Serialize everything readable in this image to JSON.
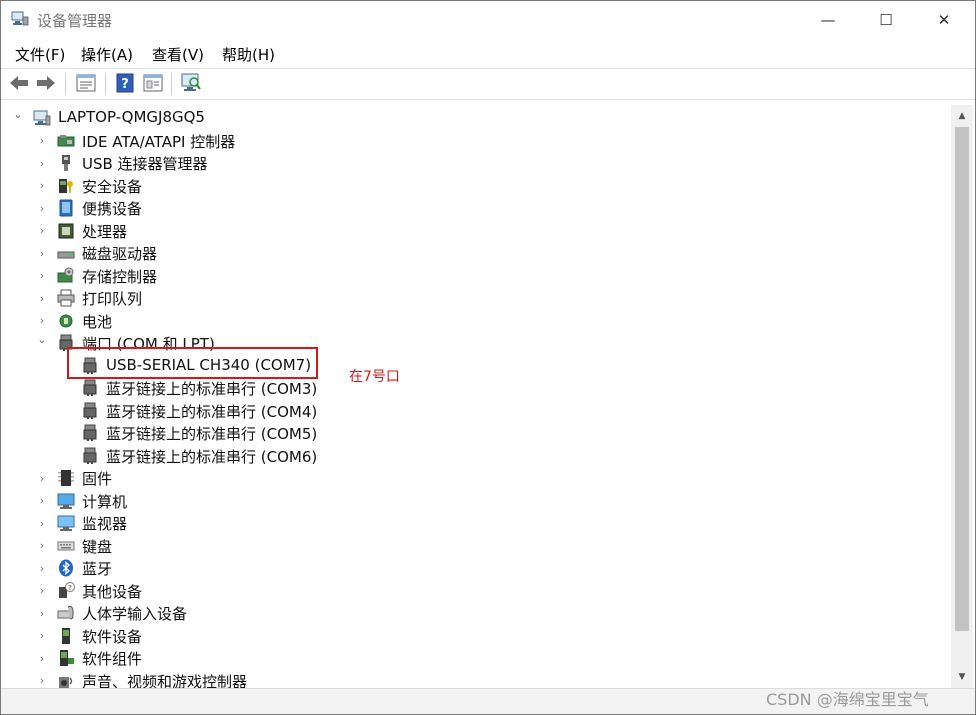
{
  "window": {
    "title": "设备管理器",
    "controls": {
      "minimize": "—",
      "maximize": "☐",
      "close": "✕"
    }
  },
  "menu": [
    "文件(F)",
    "操作(A)",
    "查看(V)",
    "帮助(H)"
  ],
  "toolbar": [
    "back-icon",
    "forward-icon",
    "properties-icon",
    "help-icon",
    "show-pane-icon",
    "scan-hardware-icon"
  ],
  "tree": {
    "root": "LAPTOP-QMGJ8GQ5",
    "categories": [
      {
        "label": "IDE ATA/ATAPI 控制器",
        "icon": "ide-controller-icon"
      },
      {
        "label": "USB 连接器管理器",
        "icon": "usb-connector-icon"
      },
      {
        "label": "安全设备",
        "icon": "security-device-icon"
      },
      {
        "label": "便携设备",
        "icon": "portable-device-icon"
      },
      {
        "label": "处理器",
        "icon": "processor-icon"
      },
      {
        "label": "磁盘驱动器",
        "icon": "disk-drive-icon"
      },
      {
        "label": "存储控制器",
        "icon": "storage-controller-icon"
      },
      {
        "label": "打印队列",
        "icon": "printer-icon"
      },
      {
        "label": "电池",
        "icon": "battery-icon"
      },
      {
        "label": "端口 (COM 和 LPT)",
        "icon": "port-icon",
        "expanded": true
      },
      {
        "label": "固件",
        "icon": "firmware-icon"
      },
      {
        "label": "计算机",
        "icon": "computer-icon"
      },
      {
        "label": "监视器",
        "icon": "monitor-icon"
      },
      {
        "label": "键盘",
        "icon": "keyboard-icon"
      },
      {
        "label": "蓝牙",
        "icon": "bluetooth-icon"
      },
      {
        "label": "其他设备",
        "icon": "other-device-icon"
      },
      {
        "label": "人体学输入设备",
        "icon": "hid-icon"
      },
      {
        "label": "软件设备",
        "icon": "software-device-icon"
      },
      {
        "label": "软件组件",
        "icon": "software-component-icon"
      },
      {
        "label": "声音、视频和游戏控制器",
        "icon": "sound-icon"
      }
    ],
    "ports": [
      "USB-SERIAL CH340 (COM7)",
      "蓝牙链接上的标准串行 (COM3)",
      "蓝牙链接上的标准串行 (COM4)",
      "蓝牙链接上的标准串行 (COM5)",
      "蓝牙链接上的标准串行 (COM6)"
    ]
  },
  "annotation": {
    "text": "在7号口",
    "color": "#d21a1a"
  },
  "watermark": "CSDN @海绵宝里宝气"
}
